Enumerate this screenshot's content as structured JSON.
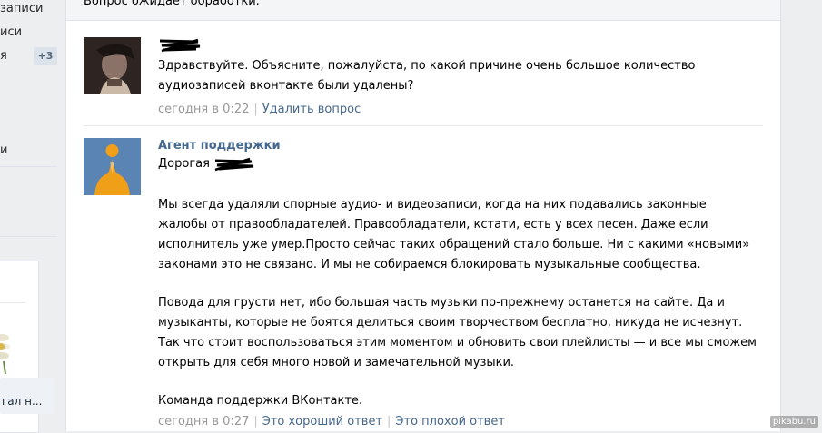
{
  "sidebar": {
    "items": [
      {
        "label": "записи"
      },
      {
        "label": "иси"
      },
      {
        "label": "я"
      },
      {
        "label": "и"
      }
    ],
    "badge": "+3",
    "chip_text": "гал н..."
  },
  "ticket": {
    "status_text": "Вопрос ожидает обработки."
  },
  "question": {
    "text": "Здравствуйте. Объясните, пожалуйста, по какой причине очень большое количество аудиозаписей вконтакте были удалены?",
    "timestamp": "сегодня в 0:22",
    "delete_link": "Удалить вопрос"
  },
  "answer": {
    "author": "Агент поддержки",
    "greeting": "Дорогая",
    "paragraph1": "Мы всегда удаляли спорные аудио- и видеозаписи, когда на них подавались законные жалобы от правообладателей. Правообладатели, кстати, есть у всех песен. Даже если исполнитель уже умер.Просто сейчас таких обращений стало больше. Ни с какими «новыми» законами это не связано. И мы не собираемся блокировать музыкальные сообщества.",
    "paragraph2": "Повода для грусти нет, ибо большая часть музыки по-прежнему останется на сайте. Да и музыканты, которые не боятся делиться своим творчеством бесплатно, никуда не исчезнут. Так что стоит воспользоваться этим моментом и обновить свои плейлисты — и все мы сможем открыть для себя много новой и замечательной музыки.",
    "signature": "Команда поддержки ВКонтакте.",
    "timestamp": "сегодня в 0:27",
    "good_link": "Это хороший ответ",
    "bad_link": "Это плохой ответ"
  },
  "watermark": "pikabu.ru",
  "colors": {
    "link": "#45688e",
    "meta": "#999999",
    "background": "#edeef0",
    "agent_avatar": "#4e78a8",
    "agent_figure": "#f0a018"
  }
}
